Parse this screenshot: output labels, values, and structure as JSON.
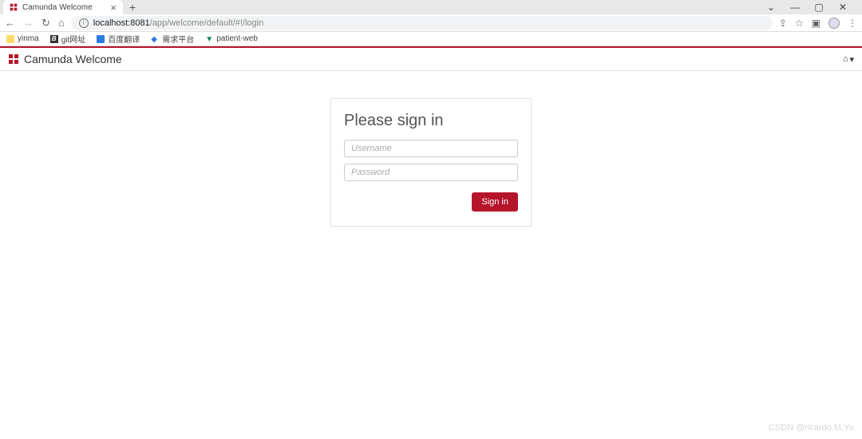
{
  "browser": {
    "tab_title": "Camunda Welcome",
    "url_host": "localhost:8081",
    "url_path": "/app/welcome/default/#!/login",
    "bookmarks": [
      {
        "label": "yinma",
        "icon": "folder"
      },
      {
        "label": "git网址",
        "icon": "b"
      },
      {
        "label": "百度翻译",
        "icon": "blue"
      },
      {
        "label": "需求平台",
        "icon": "diamond"
      },
      {
        "label": "patient-web",
        "icon": "v"
      }
    ]
  },
  "app": {
    "header_title": "Camunda Welcome"
  },
  "login": {
    "title": "Please sign in",
    "username_placeholder": "Username",
    "password_placeholder": "Password",
    "signin_label": "Sign in"
  },
  "watermark": "CSDN @ricardo.M.Yu"
}
